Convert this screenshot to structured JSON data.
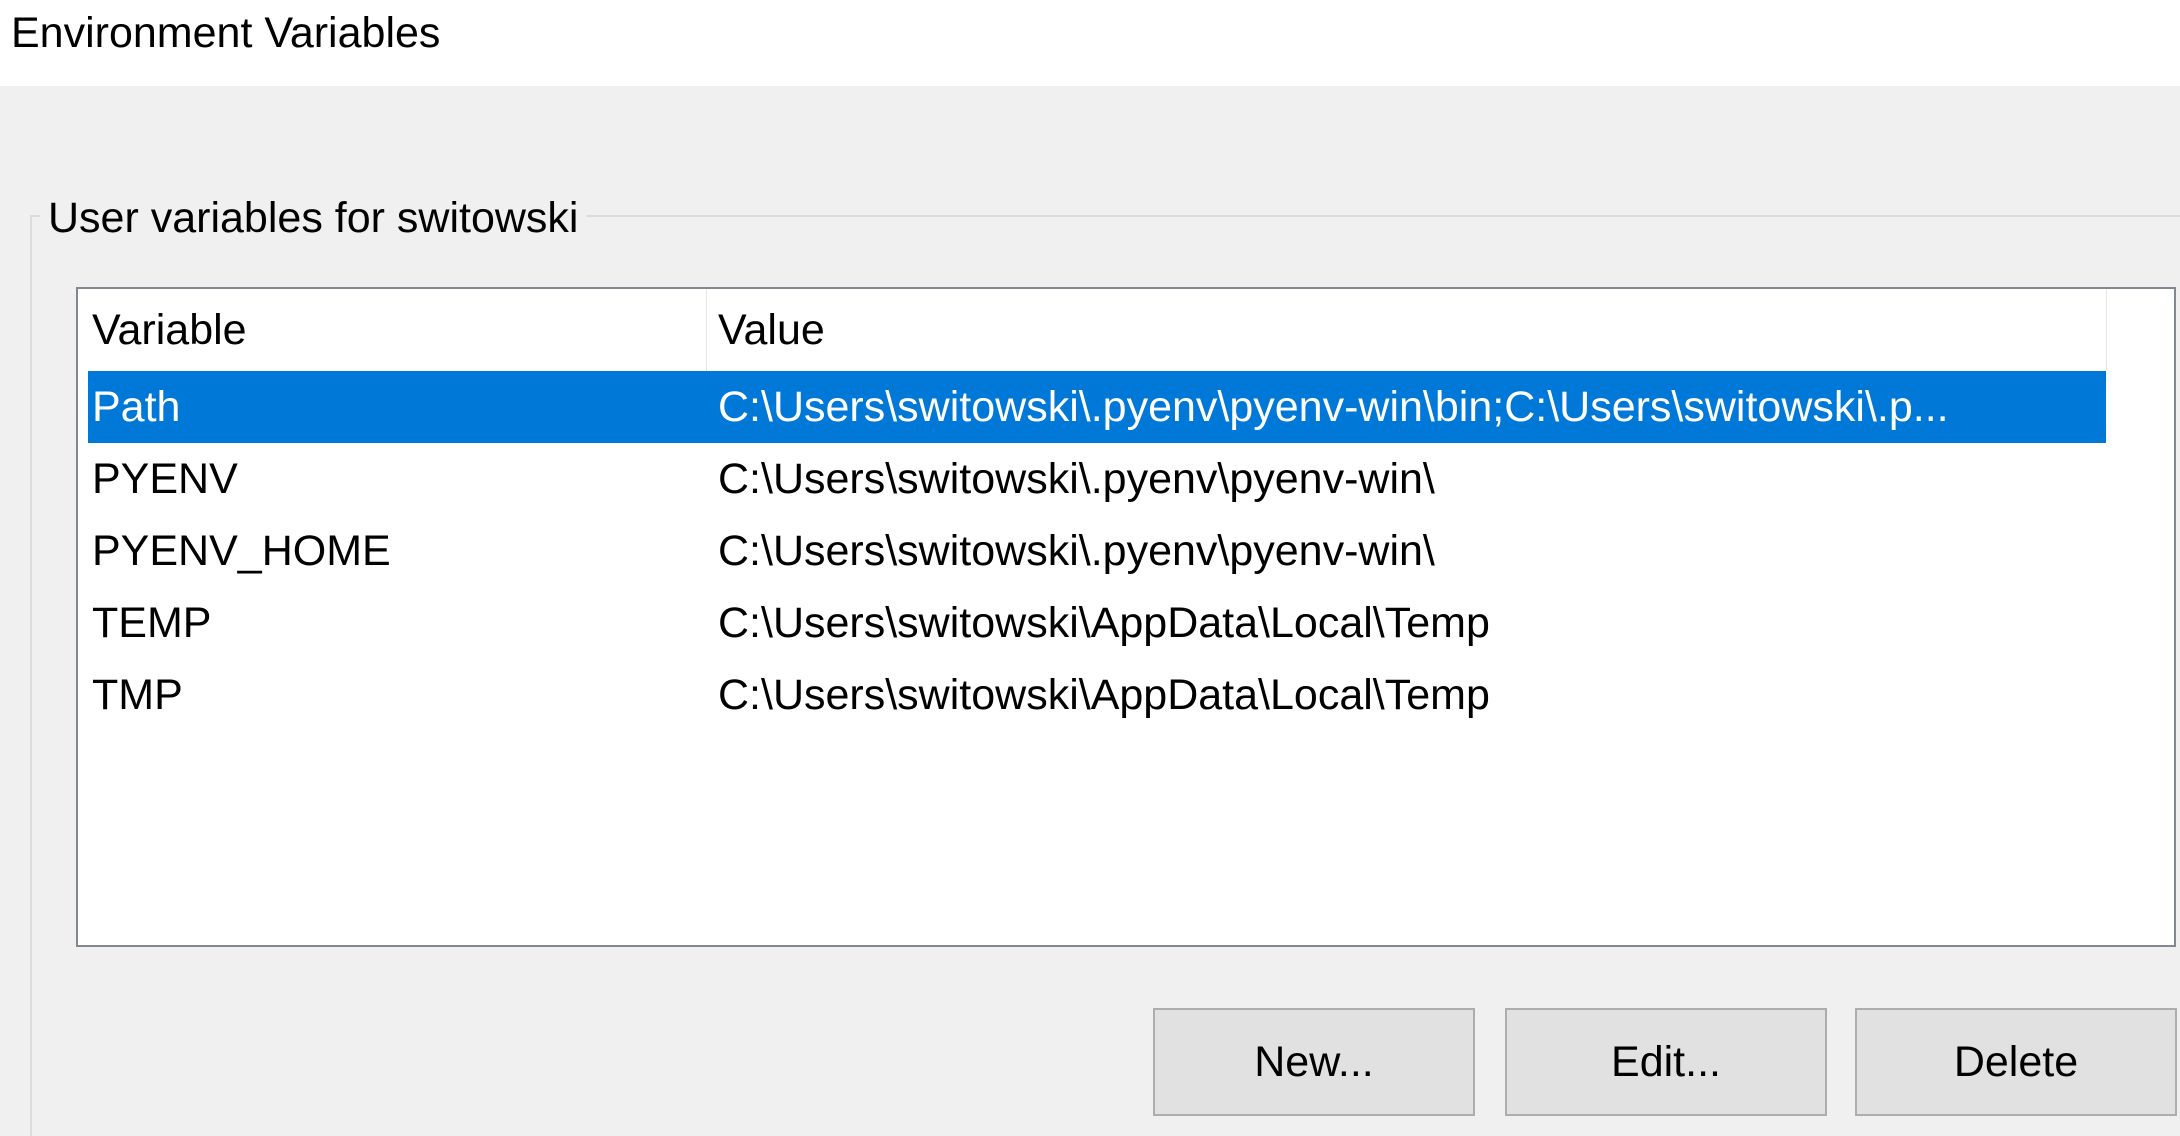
{
  "window": {
    "title": "Environment Variables"
  },
  "user_group": {
    "legend": "User variables for switowski",
    "columns": {
      "variable": "Variable",
      "value": "Value"
    },
    "rows": [
      {
        "variable": "Path",
        "value": "C:\\Users\\switowski\\.pyenv\\pyenv-win\\bin;C:\\Users\\switowski\\.p...",
        "selected": true
      },
      {
        "variable": "PYENV",
        "value": "C:\\Users\\switowski\\.pyenv\\pyenv-win\\",
        "selected": false
      },
      {
        "variable": "PYENV_HOME",
        "value": "C:\\Users\\switowski\\.pyenv\\pyenv-win\\",
        "selected": false
      },
      {
        "variable": "TEMP",
        "value": "C:\\Users\\switowski\\AppData\\Local\\Temp",
        "selected": false
      },
      {
        "variable": "TMP",
        "value": "C:\\Users\\switowski\\AppData\\Local\\Temp",
        "selected": false
      }
    ],
    "buttons": {
      "new": "New...",
      "edit": "Edit...",
      "delete": "Delete"
    }
  },
  "colors": {
    "selection": "#0078d7",
    "background": "#f0f0f0"
  }
}
